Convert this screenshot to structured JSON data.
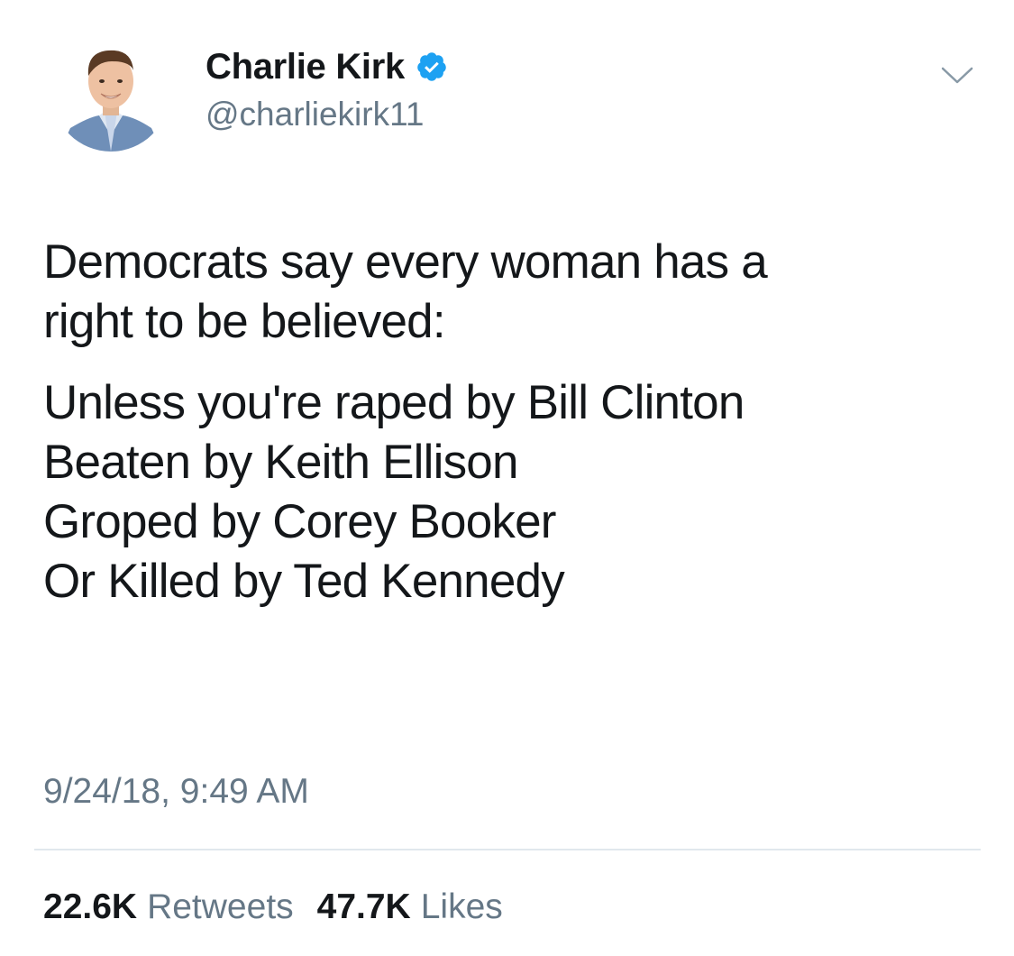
{
  "author": {
    "display_name": "Charlie Kirk",
    "handle": "@charliekirk11",
    "verified": true,
    "avatar_icon": "profile-photo",
    "verified_icon": "verified-badge-icon",
    "verified_color": "#1da1f2"
  },
  "menu_icon": "chevron-down-icon",
  "tweet": {
    "lines": [
      "Democrats say every woman has a",
      "right to be believed:",
      "Unless you're raped by Bill Clinton",
      "Beaten by Keith Ellison",
      "Groped by Corey Booker",
      "Or Killed by Ted Kennedy"
    ]
  },
  "timestamp": "9/24/18, 9:49 AM",
  "stats": {
    "retweets_count": "22.6K",
    "retweets_label": "Retweets",
    "likes_count": "47.7K",
    "likes_label": "Likes"
  },
  "colors": {
    "text": "#14171a",
    "secondary": "#657786",
    "divider": "#e1e8ed"
  }
}
